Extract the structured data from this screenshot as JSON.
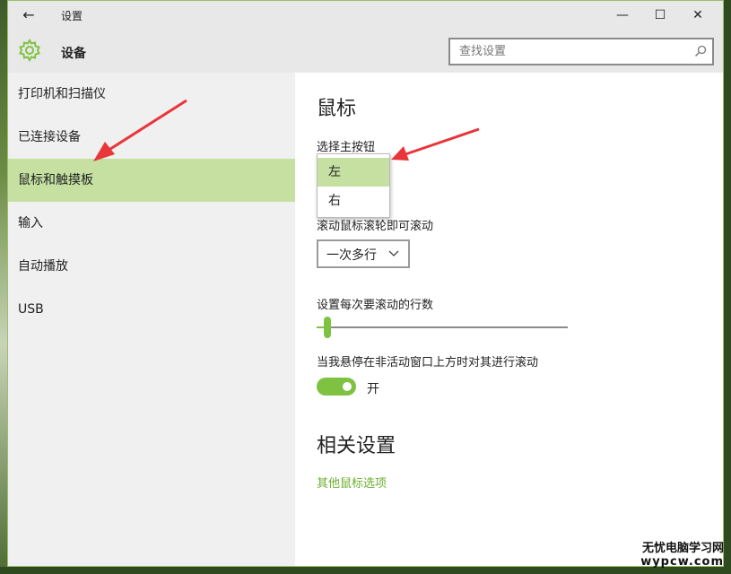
{
  "window": {
    "title": "设置",
    "back_icon": "←",
    "minimize_icon": "—",
    "maximize_icon": "☐",
    "close_icon": "✕"
  },
  "header": {
    "title": "设备",
    "search_placeholder": "查找设置"
  },
  "sidebar": {
    "items": [
      {
        "label": "打印机和扫描仪",
        "active": false
      },
      {
        "label": "已连接设备",
        "active": false
      },
      {
        "label": "鼠标和触摸板",
        "active": true
      },
      {
        "label": "输入",
        "active": false
      },
      {
        "label": "自动播放",
        "active": false
      },
      {
        "label": "USB",
        "active": false
      }
    ]
  },
  "main": {
    "section_title": "鼠标",
    "primary_button_label": "选择主按钮",
    "primary_button_options": [
      "左",
      "右"
    ],
    "primary_button_selected": "左",
    "scroll_label": "滚动鼠标滚轮即可滚动",
    "scroll_value": "一次多行",
    "lines_label": "设置每次要滚动的行数",
    "lines_slider_fraction": 0.03,
    "inactive_scroll_label": "当我悬停在非活动窗口上方时对其进行滚动",
    "inactive_scroll_toggle_label": "开",
    "inactive_scroll_on": true,
    "related_title": "相关设置",
    "related_link": "其他鼠标选项"
  },
  "watermark": {
    "line1": "无忧电脑学习网",
    "line2": "wypcw.com"
  },
  "colors": {
    "accent": "#7fc241",
    "active_item": "#c5e0a1",
    "arrow": "#e8363a"
  }
}
